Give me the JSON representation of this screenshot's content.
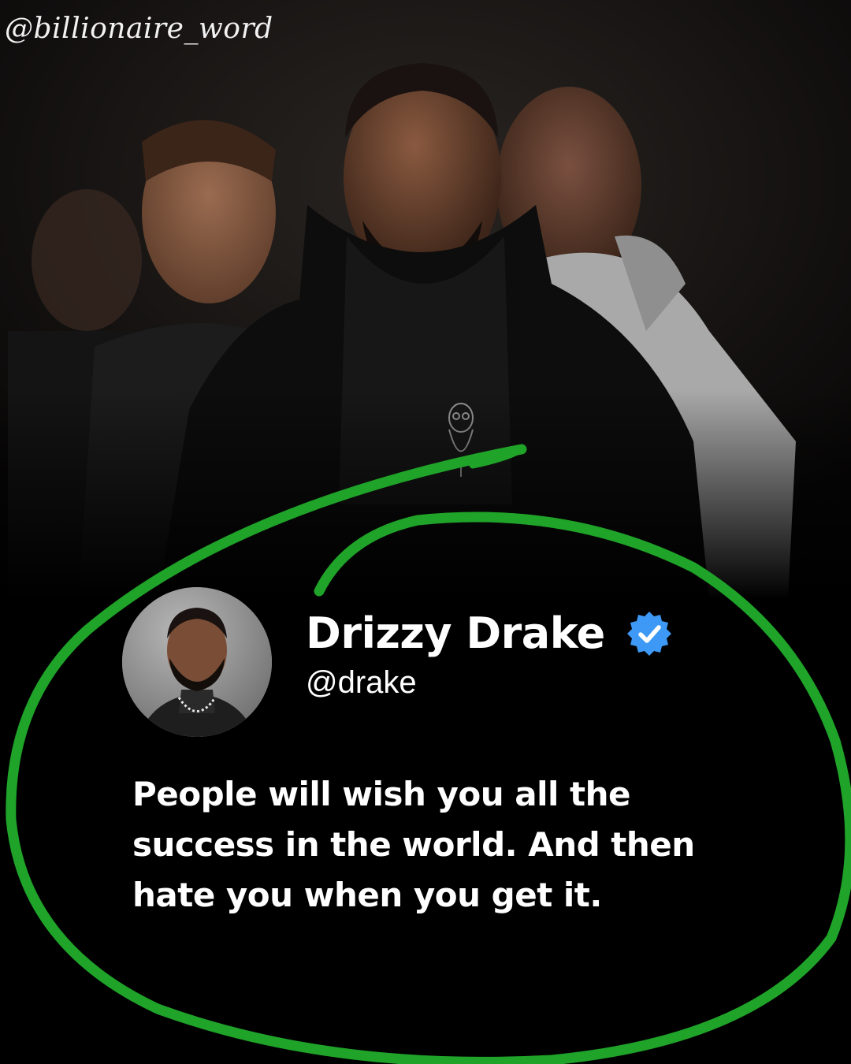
{
  "watermark": "@billionaire_word",
  "tweet": {
    "display_name": "Drizzy Drake",
    "handle": "@drake",
    "text": "People will wish you all the success in the world. And then hate you when you get it.",
    "verified_icon": "verified-badge-icon"
  },
  "colors": {
    "background": "#000000",
    "accent_ring": "#1fa329",
    "verified_badge": "#3d99f5",
    "text": "#ffffff"
  }
}
